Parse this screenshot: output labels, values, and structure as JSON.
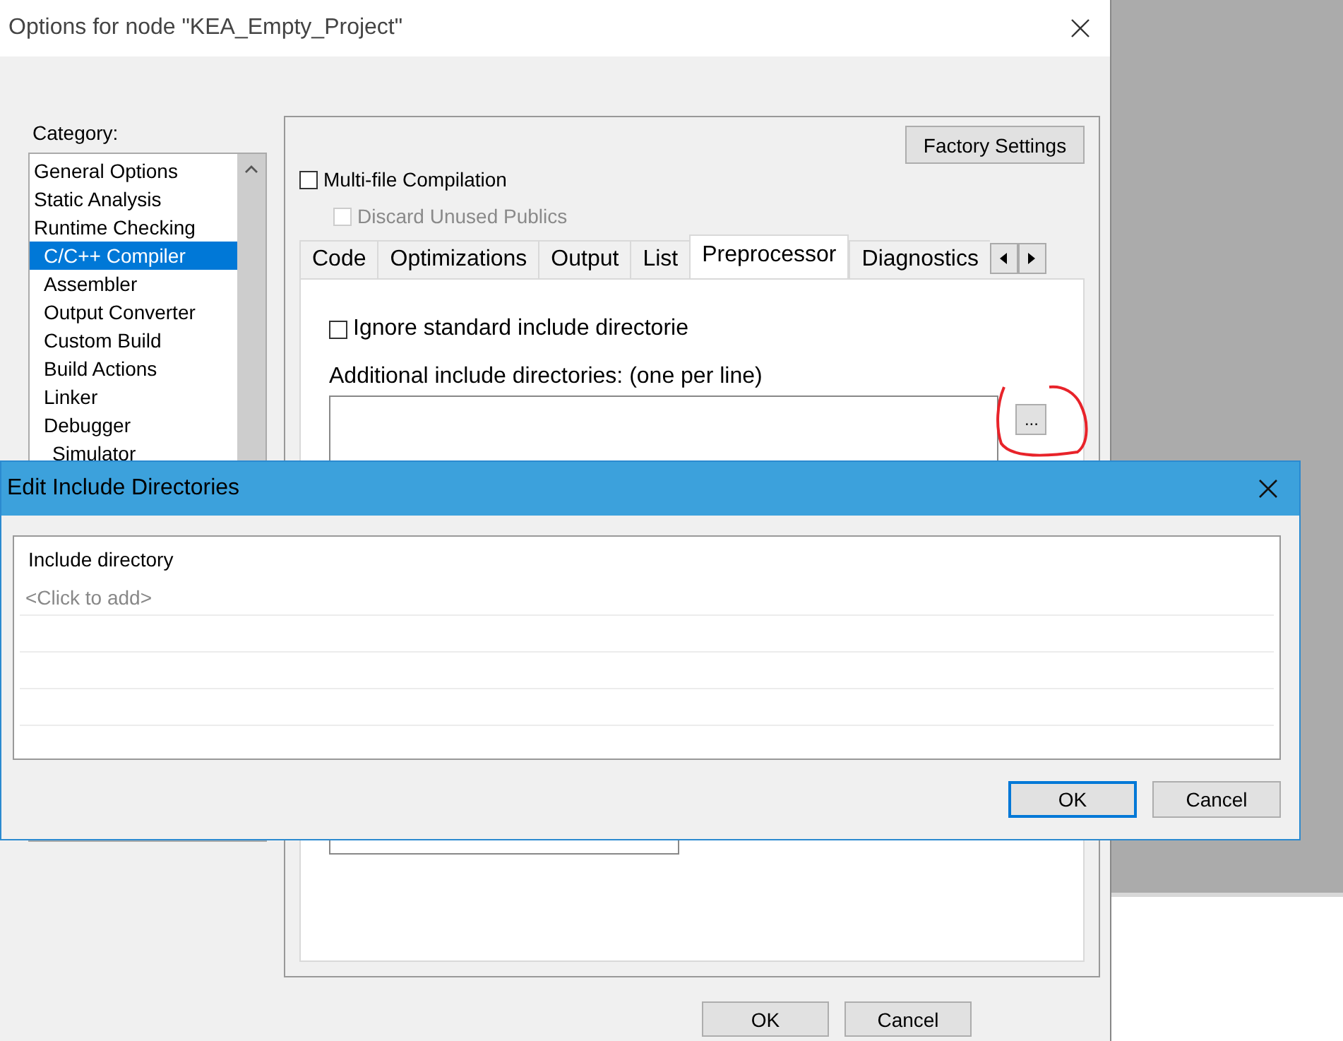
{
  "options_window": {
    "title": "Options for node \"KEA_Empty_Project\"",
    "category_label": "Category:",
    "categories": [
      {
        "label": "General Options",
        "kind": "general",
        "selected": false
      },
      {
        "label": "Static Analysis",
        "kind": "general",
        "selected": false
      },
      {
        "label": "Runtime Checking",
        "kind": "general",
        "selected": false
      },
      {
        "label": "C/C++ Compiler",
        "kind": "tool",
        "selected": true
      },
      {
        "label": "Assembler",
        "kind": "tool",
        "selected": false
      },
      {
        "label": "Output Converter",
        "kind": "tool",
        "selected": false
      },
      {
        "label": "Custom Build",
        "kind": "tool",
        "selected": false
      },
      {
        "label": "Build Actions",
        "kind": "tool",
        "selected": false
      },
      {
        "label": "Linker",
        "kind": "tool",
        "selected": false
      },
      {
        "label": "Debugger",
        "kind": "tool",
        "selected": false,
        "children": [
          {
            "label": "Simulator",
            "selected": false
          }
        ]
      }
    ],
    "factory_settings_button": "Factory Settings",
    "multi_file": {
      "label": "Multi-file Compilation",
      "checked": false,
      "disabled": false
    },
    "discard_unused": {
      "label": "Discard Unused Publics",
      "checked": false,
      "disabled": true
    },
    "tabs": [
      {
        "label": "Code",
        "selected": false
      },
      {
        "label": "Optimizations",
        "selected": false
      },
      {
        "label": "Output",
        "selected": false
      },
      {
        "label": "List",
        "selected": false
      },
      {
        "label": "Preprocessor",
        "selected": true
      },
      {
        "label": "Diagnostics",
        "selected": false
      }
    ],
    "ignore_standard": {
      "label": "Ignore standard include directorie",
      "checked": false
    },
    "additional_label": "Additional include directories: (one per line)",
    "browse_button": "...",
    "buttons": [
      "OK",
      "Cancel"
    ]
  },
  "edit_dialog": {
    "title": "Edit Include Directories",
    "column_header": "Include directory",
    "placeholder_row": "<Click to add>",
    "buttons": [
      {
        "label": "OK",
        "default": true
      },
      {
        "label": "Cancel",
        "default": false
      }
    ]
  }
}
